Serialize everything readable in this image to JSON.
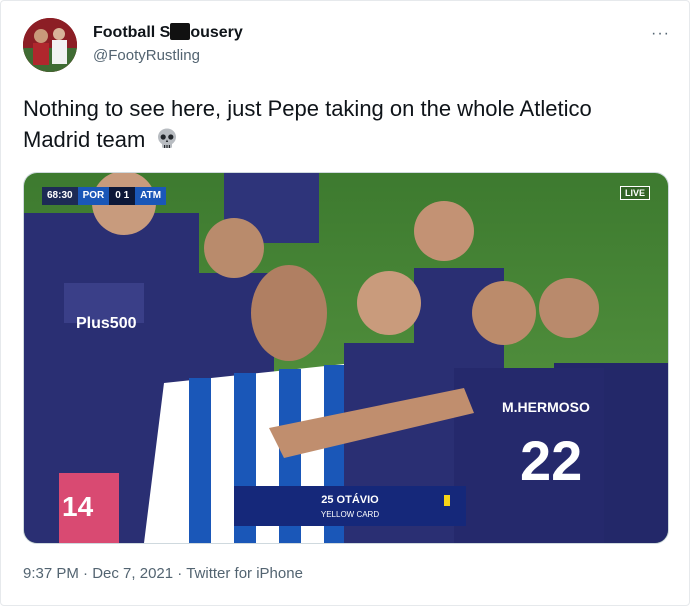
{
  "author": {
    "name_prefix": "Football S",
    "name_suffix": "ousery",
    "handle": "@FootyRustling"
  },
  "tweet": {
    "text": "Nothing to see here, just Pepe taking on the whole Atletico Madrid team",
    "emoji": "skull-icon"
  },
  "media": {
    "clock": "68:30",
    "team_home": "POR",
    "score": "0 1",
    "team_away": "ATM",
    "live_label": "LIVE",
    "shirt_sponsor": "Plus500",
    "shirt_number_left": "14",
    "shirt_number_right": "22",
    "shirt_name_right": "M.HERMOSO",
    "banner_player": "25 OTÁVIO",
    "banner_label": "YELLOW CARD"
  },
  "meta": {
    "time": "9:37 PM",
    "date": "Dec 7, 2021",
    "source": "Twitter for iPhone"
  },
  "colors": {
    "text": "#0f1419",
    "secondary": "#536471",
    "pitch": "#4f8f3a",
    "atletico_kit": "#2a2f73",
    "porto_blue": "#1a57b8",
    "yellow_card": "#f7d417"
  }
}
